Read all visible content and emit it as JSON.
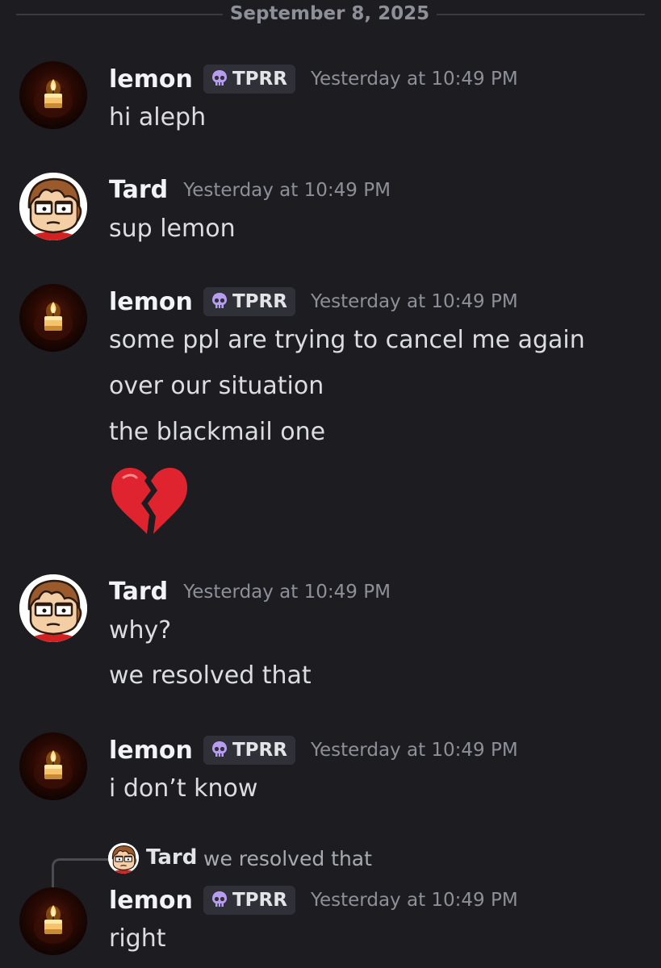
{
  "divider": {
    "date": "September 8, 2025"
  },
  "users": {
    "lemon": {
      "name": "lemon",
      "tag": "TPRR",
      "avatar_icon": "candle-avatar-icon"
    },
    "tard": {
      "name": "Tard",
      "avatar_icon": "cartoon-boy-avatar-icon"
    }
  },
  "messages": [
    {
      "user": "lemon",
      "tag": "TPRR",
      "timestamp": "Yesterday at 10:49 PM",
      "lines": [
        "hi aleph"
      ]
    },
    {
      "user": "Tard",
      "timestamp": "Yesterday at 10:49 PM",
      "lines": [
        "sup lemon"
      ]
    },
    {
      "user": "lemon",
      "tag": "TPRR",
      "timestamp": "Yesterday at 10:49 PM",
      "lines": [
        "some ppl are trying to cancel me again",
        "over our situation",
        "the blackmail one"
      ],
      "emoji": "broken-heart-icon"
    },
    {
      "user": "Tard",
      "timestamp": "Yesterday at 10:49 PM",
      "lines": [
        "why?",
        "we resolved that"
      ]
    },
    {
      "user": "lemon",
      "tag": "TPRR",
      "timestamp": "Yesterday at 10:49 PM",
      "lines": [
        "i don’t know"
      ]
    },
    {
      "user": "lemon",
      "tag": "TPRR",
      "timestamp": "Yesterday at 10:49 PM",
      "lines": [
        "right"
      ],
      "reply_to": {
        "user": "Tard",
        "text": "we resolved that"
      }
    }
  ],
  "colors": {
    "background": "#1c1c21",
    "username": "#f2f3f5",
    "timestamp": "#8e9099",
    "text": "#dcdde1",
    "tag_bg": "#2f3038",
    "skull": "#b79cf2"
  }
}
